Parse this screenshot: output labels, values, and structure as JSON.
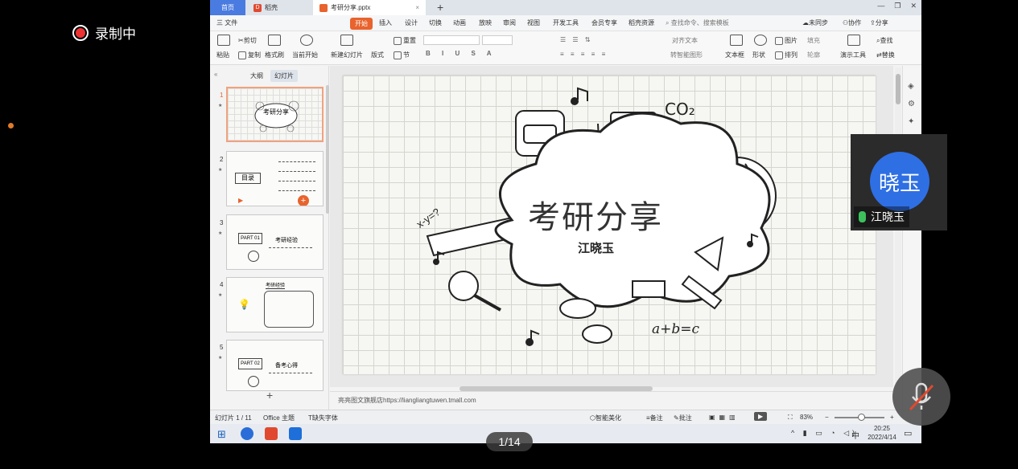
{
  "recording": {
    "label": "录制中"
  },
  "window": {
    "tabs": [
      {
        "label": "首页"
      },
      {
        "label": "稻壳"
      },
      {
        "label": "考研分享.pptx"
      }
    ],
    "menus": [
      "三 文件",
      "开始",
      "插入",
      "设计",
      "切换",
      "动画",
      "放映",
      "审阅",
      "视图",
      "开发工具",
      "会员专享",
      "稻壳资源",
      "查找命令、搜索模板",
      "未同步",
      "协作",
      "分享"
    ],
    "ribbon": {
      "paste": "粘贴",
      "cut": "剪切",
      "copy": "复制",
      "format_painter": "格式刷",
      "from_current": "当前开始",
      "new_slide": "新建幻灯片",
      "layout": "版式",
      "section": "节",
      "reset": "重置",
      "align_text": "对齐文本",
      "convert_smartart": "转智能图形",
      "textbox": "文本框",
      "shape": "形状",
      "picture": "图片",
      "arrange": "排列",
      "fill": "填充",
      "outline": "轮廓",
      "present_tools": "演示工具",
      "find": "查找",
      "replace": "替换"
    },
    "panel_tabs": [
      "大纲",
      "幻灯片"
    ],
    "thumbnails": [
      {
        "num": "1",
        "title": "考研分享"
      },
      {
        "num": "2",
        "title": "目录"
      },
      {
        "num": "3",
        "title": "PART 01",
        "sub": "考研经验"
      },
      {
        "num": "4",
        "title": "考研经验"
      },
      {
        "num": "5",
        "title": "PART 02",
        "sub": "备考心得"
      }
    ],
    "slide": {
      "title": "考研分享",
      "author": "江晓玉",
      "co2": "CO₂",
      "formula": "a+b=c",
      "xyz": "x-y=?"
    },
    "notes": "亮亮图文旗舰店https://liangliangtuwen.tmall.com",
    "status": {
      "slide_count": "幻灯片 1 / 11",
      "theme": "Office 主题",
      "missing_fonts": "缺失字体",
      "smart_beautify": "智能美化",
      "notes_btn": "备注",
      "comments_btn": "批注",
      "zoom": "83%"
    },
    "taskbar": {
      "ime": "中",
      "time": "20:25",
      "date": "2022/4/14"
    }
  },
  "meeting": {
    "avatar_text": "晓玉",
    "participant": "江晓玉",
    "page": "1/14"
  }
}
